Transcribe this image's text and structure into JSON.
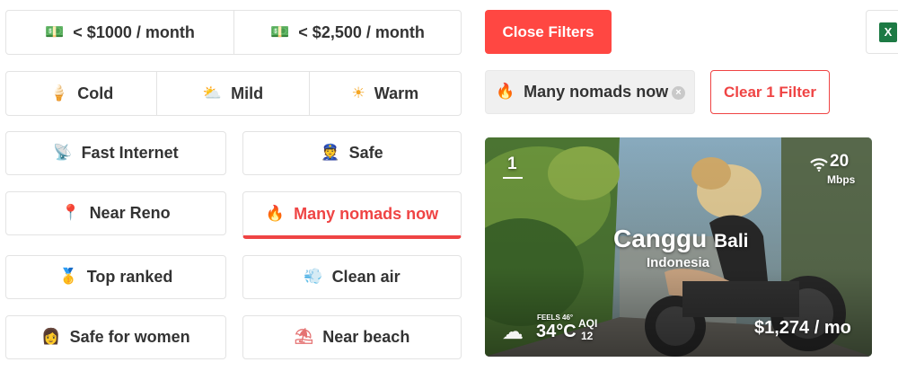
{
  "filters": {
    "price": [
      {
        "icon": "money-icon",
        "glyph": "💵",
        "label": "< $1000 / month"
      },
      {
        "icon": "money-icon",
        "glyph": "💵",
        "label": "< $2,500 / month"
      }
    ],
    "climate": [
      {
        "icon": "ice-cream-icon",
        "glyph": "🍦",
        "label": "Cold"
      },
      {
        "icon": "sun-cloud-icon",
        "glyph": "⛅",
        "label": "Mild"
      },
      {
        "icon": "sun-icon",
        "glyph": "☀",
        "label": "Warm"
      }
    ],
    "fast_internet": {
      "icon": "satellite-icon",
      "glyph": "📡",
      "label": "Fast Internet"
    },
    "safe": {
      "icon": "police-icon",
      "glyph": "👮",
      "label": "Safe"
    },
    "near_reno": {
      "icon": "pin-icon",
      "glyph": "📍",
      "label": "Near Reno"
    },
    "many_nomads": {
      "icon": "fire-icon",
      "glyph": "🔥",
      "label": "Many nomads now",
      "active": true
    },
    "top_ranked": {
      "icon": "medal-icon",
      "glyph": "🥇",
      "label": "Top ranked"
    },
    "clean_air": {
      "icon": "wind-icon",
      "glyph": "💨",
      "label": "Clean air"
    },
    "safe_women": {
      "icon": "woman-icon",
      "glyph": "👩",
      "label": "Safe for women"
    },
    "near_beach": {
      "icon": "umbrella-icon",
      "glyph": "⛱",
      "label": "Near beach"
    }
  },
  "toolbar": {
    "close_label": "Close Filters",
    "excel_icon": "excel-icon",
    "excel_glyph": "X"
  },
  "active_filter": {
    "icon": "fire-icon",
    "glyph": "🔥",
    "label": "Many nomads now",
    "remove_glyph": "×",
    "clear_label": "Clear 1 Filter"
  },
  "card": {
    "rank": "1",
    "city": "Canggu",
    "region": "Bali",
    "country": "Indonesia",
    "internet_speed": "20",
    "internet_unit": "Mbps",
    "feels_label": "FEELS 46°",
    "temperature": "34°C",
    "aqi_label": "AQI",
    "aqi_value": "12",
    "price": "$1,274 / mo",
    "weather_icon": "cloud-icon",
    "weather_glyph": "☁"
  },
  "colors": {
    "accent": "#ff4742",
    "active_text": "#ef4444",
    "excel": "#1d7a44"
  }
}
